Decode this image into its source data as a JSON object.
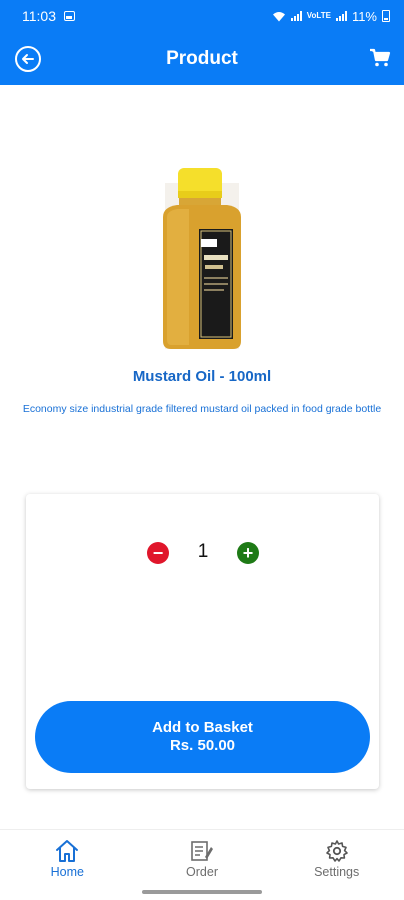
{
  "status_bar": {
    "time": "11:03",
    "battery_text": "11%",
    "icons": [
      "photo-icon",
      "wifi-icon",
      "signal-icon",
      "volte-signal-icon",
      "signal-icon",
      "battery-icon"
    ]
  },
  "app_bar": {
    "title": "Product",
    "back_icon": "back-arrow-circle-icon",
    "cart_icon": "cart-icon",
    "color": "#0a7cf6"
  },
  "product": {
    "name": "Mustard Oil - 100ml",
    "description": "Economy size industrial grade filtered mustard oil packed in food grade bottle"
  },
  "quantity": {
    "value": "1",
    "minus_symbol": "−",
    "plus_symbol": "+"
  },
  "add_button": {
    "label": "Add to Basket",
    "price": "Rs. 50.00"
  },
  "bottom_nav": {
    "items": [
      {
        "label": "Home",
        "icon": "home-icon",
        "active": true
      },
      {
        "label": "Order",
        "icon": "order-icon",
        "active": false
      },
      {
        "label": "Settings",
        "icon": "settings-gear-icon",
        "active": false
      }
    ]
  }
}
